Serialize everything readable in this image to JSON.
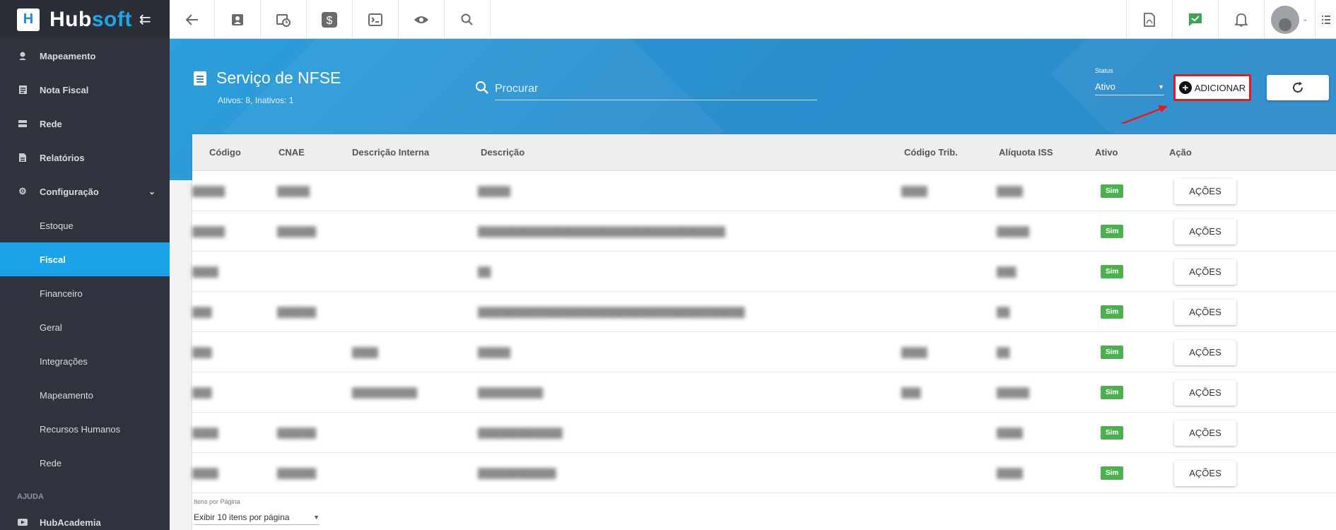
{
  "brand": {
    "name_a": "Hub",
    "name_b": "soft"
  },
  "sidebar": {
    "items": [
      {
        "label": "Mapeamento",
        "icon": "map-pin-icon"
      },
      {
        "label": "Nota Fiscal",
        "icon": "receipt-icon"
      },
      {
        "label": "Rede",
        "icon": "server-icon"
      },
      {
        "label": "Relatórios",
        "icon": "report-icon"
      },
      {
        "label": "Configuração",
        "icon": "gear-icon"
      }
    ],
    "sub_items": [
      "Estoque",
      "Fiscal",
      "Financeiro",
      "Geral",
      "Integrações",
      "Mapeamento",
      "Recursos Humanos",
      "Rede"
    ],
    "active_sub": "Fiscal",
    "section_help": "AJUDA",
    "help_items": [
      {
        "label": "HubAcademia",
        "icon": "youtube-icon"
      }
    ]
  },
  "topbar": {
    "icons": [
      "back-arrow-icon",
      "contact-card-icon",
      "calendar-clock-icon",
      "dollar-icon",
      "terminal-icon",
      "eye-icon",
      "search-icon"
    ],
    "right_icons": [
      "pdf-icon",
      "checked-message-icon",
      "bell-icon",
      "user-avatar",
      "list-icon"
    ]
  },
  "header": {
    "title": "Serviço de NFSE",
    "subtitle": "Ativos: 8, Inativos: 1",
    "search_placeholder": "Procurar",
    "status_label": "Status",
    "status_value": "Ativo",
    "add_label": "ADICIONAR"
  },
  "table": {
    "columns": [
      "Código",
      "CNAE",
      "Descrição Interna",
      "Descrição",
      "Código Trib.",
      "Alíquota ISS",
      "Ativo",
      "Ação"
    ],
    "rows": [
      {
        "codigo": "█████",
        "cnae": "█████",
        "desc_interna": "",
        "descricao": "█████",
        "cod_trib": "████",
        "aliquota": "████",
        "ativo": "Sim",
        "acao": "AÇÕES"
      },
      {
        "codigo": "█████",
        "cnae": "██████",
        "desc_interna": "",
        "descricao": "██████████████████████████████████████",
        "cod_trib": "",
        "aliquota": "█████",
        "ativo": "Sim",
        "acao": "AÇÕES"
      },
      {
        "codigo": "████",
        "cnae": "",
        "desc_interna": "",
        "descricao": "██",
        "cod_trib": "",
        "aliquota": "███",
        "ativo": "Sim",
        "acao": "AÇÕES"
      },
      {
        "codigo": "███",
        "cnae": "██████",
        "desc_interna": "",
        "descricao": "█████████████████████████████████████████",
        "cod_trib": "",
        "aliquota": "██",
        "ativo": "Sim",
        "acao": "AÇÕES"
      },
      {
        "codigo": "███",
        "cnae": "",
        "desc_interna": "████",
        "descricao": "█████",
        "cod_trib": "████",
        "aliquota": "██",
        "ativo": "Sim",
        "acao": "AÇÕES"
      },
      {
        "codigo": "███",
        "cnae": "",
        "desc_interna": "██████████",
        "descricao": "██████████",
        "cod_trib": "███",
        "aliquota": "█████",
        "ativo": "Sim",
        "acao": "AÇÕES"
      },
      {
        "codigo": "████",
        "cnae": "██████",
        "desc_interna": "",
        "descricao": "█████████████",
        "cod_trib": "",
        "aliquota": "████",
        "ativo": "Sim",
        "acao": "AÇÕES"
      },
      {
        "codigo": "████",
        "cnae": "██████",
        "desc_interna": "",
        "descricao": "████████████",
        "cod_trib": "",
        "aliquota": "████",
        "ativo": "Sim",
        "acao": "AÇÕES"
      }
    ]
  },
  "pagination": {
    "label": "Itens por Página",
    "value": "Exibir 10 itens por página"
  },
  "colors": {
    "sidebar_bg": "#2f333d",
    "accent": "#1aa3e8",
    "header_bg": "#2b90cf",
    "badge": "#4caf50",
    "highlight": "#e01b24"
  }
}
